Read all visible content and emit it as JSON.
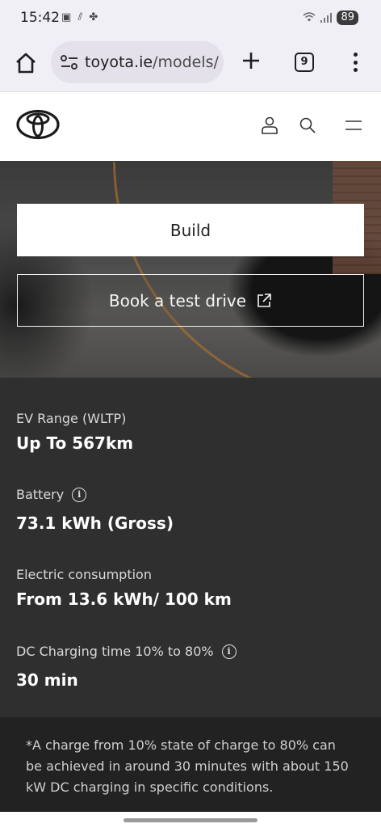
{
  "status_bar": {
    "time": "15:42",
    "left_icons": [
      "screenshot-icon",
      "hashtag-icon",
      "fan-icon"
    ],
    "battery": "89"
  },
  "browser": {
    "url_host": "toyota.ie",
    "url_path": "/models/",
    "tab_count": "9"
  },
  "header": {
    "icons": [
      "toyota-logo",
      "user-icon",
      "search-icon",
      "hamburger-menu-icon"
    ]
  },
  "hero": {
    "build_label": "Build",
    "test_drive_label": "Book a test drive"
  },
  "specs": [
    {
      "label": "EV Range (WLTP)",
      "value": "Up To 567km",
      "info": false
    },
    {
      "label": "Battery",
      "value": "73.1 kWh (Gross)",
      "info": true
    },
    {
      "label": "Electric consumption",
      "value": "From 13.6 kWh/ 100 km",
      "info": false
    },
    {
      "label": "DC Charging time 10% to 80%",
      "value": "30 min",
      "info": true
    }
  ],
  "footnote": "*A charge from 10% state of charge to 80% can be achieved in around 30 minutes with about 150 kW DC charging in specific conditions.",
  "colors": {
    "specs_bg": "#2f2f2f",
    "footnote_bg": "#222222",
    "browser_bg": "#f1eff6"
  }
}
